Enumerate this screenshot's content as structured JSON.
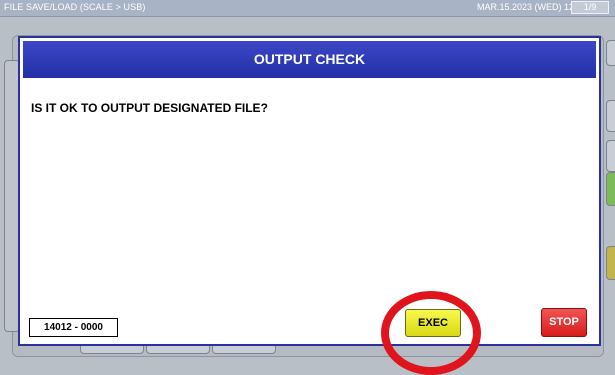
{
  "titlebar": {
    "title": "FILE SAVE/LOAD (SCALE > USB)",
    "datetime": "MAR.15.2023 (WED)  12:32",
    "page": "1/9"
  },
  "dialog": {
    "title": "OUTPUT CHECK",
    "message": "IS IT OK TO OUTPUT DESIGNATED FILE?",
    "code": "14012 - 0000",
    "exec_label": "EXEC",
    "stop_label": "STOP"
  },
  "colors": {
    "header_blue": "#2b339a",
    "exec_yellow": "#e8e82a",
    "stop_red": "#e02828",
    "highlight_circle": "#e0141c"
  }
}
